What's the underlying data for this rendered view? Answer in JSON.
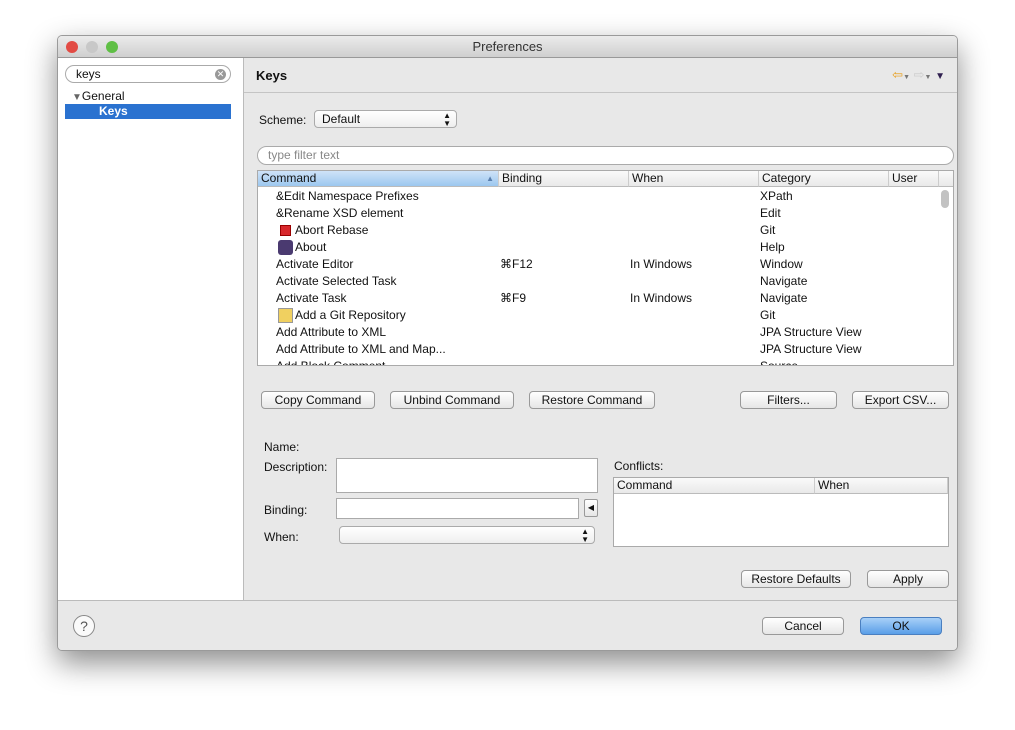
{
  "window": {
    "title": "Preferences"
  },
  "sidebar": {
    "search_value": "keys",
    "tree": [
      {
        "label": "General",
        "expanded": true
      },
      {
        "label": "Keys",
        "selected": true
      }
    ]
  },
  "page": {
    "title": "Keys",
    "scheme": {
      "label": "Scheme:",
      "value": "Default"
    },
    "filter_placeholder": "type filter text",
    "table": {
      "columns": [
        "Command",
        "Binding",
        "When",
        "Category",
        "User"
      ],
      "rows": [
        {
          "command": "&Edit Namespace Prefixes",
          "binding": "",
          "when": "",
          "category": "XPath",
          "icon": ""
        },
        {
          "command": "&Rename XSD element",
          "binding": "",
          "when": "",
          "category": "Edit",
          "icon": ""
        },
        {
          "command": "Abort Rebase",
          "binding": "",
          "when": "",
          "category": "Git",
          "icon": "stop-icon"
        },
        {
          "command": "About",
          "binding": "",
          "when": "",
          "category": "Help",
          "icon": "eclipse-icon"
        },
        {
          "command": "Activate Editor",
          "binding": "⌘F12",
          "when": "In Windows",
          "category": "Window",
          "icon": ""
        },
        {
          "command": "Activate Selected Task",
          "binding": "",
          "when": "",
          "category": "Navigate",
          "icon": ""
        },
        {
          "command": "Activate Task",
          "binding": "⌘F9",
          "when": "In Windows",
          "category": "Navigate",
          "icon": ""
        },
        {
          "command": "Add a Git Repository",
          "binding": "",
          "when": "",
          "category": "Git",
          "icon": "git-repo-icon"
        },
        {
          "command": "Add Attribute to XML",
          "binding": "",
          "when": "",
          "category": "JPA Structure View",
          "icon": ""
        },
        {
          "command": "Add Attribute to XML and Map...",
          "binding": "",
          "when": "",
          "category": "JPA Structure View",
          "icon": ""
        },
        {
          "command": "Add Block Comment",
          "binding": "",
          "when": "",
          "category": "Source",
          "icon": ""
        }
      ]
    },
    "buttons": {
      "copy": "Copy Command",
      "unbind": "Unbind Command",
      "restore": "Restore Command",
      "filters": "Filters...",
      "export": "Export CSV..."
    },
    "details": {
      "name_label": "Name:",
      "description_label": "Description:",
      "binding_label": "Binding:",
      "when_label": "When:",
      "conflicts_label": "Conflicts:",
      "conflict_columns": [
        "Command",
        "When"
      ]
    },
    "restore_defaults": "Restore Defaults",
    "apply": "Apply"
  },
  "footer": {
    "cancel": "Cancel",
    "ok": "OK"
  }
}
